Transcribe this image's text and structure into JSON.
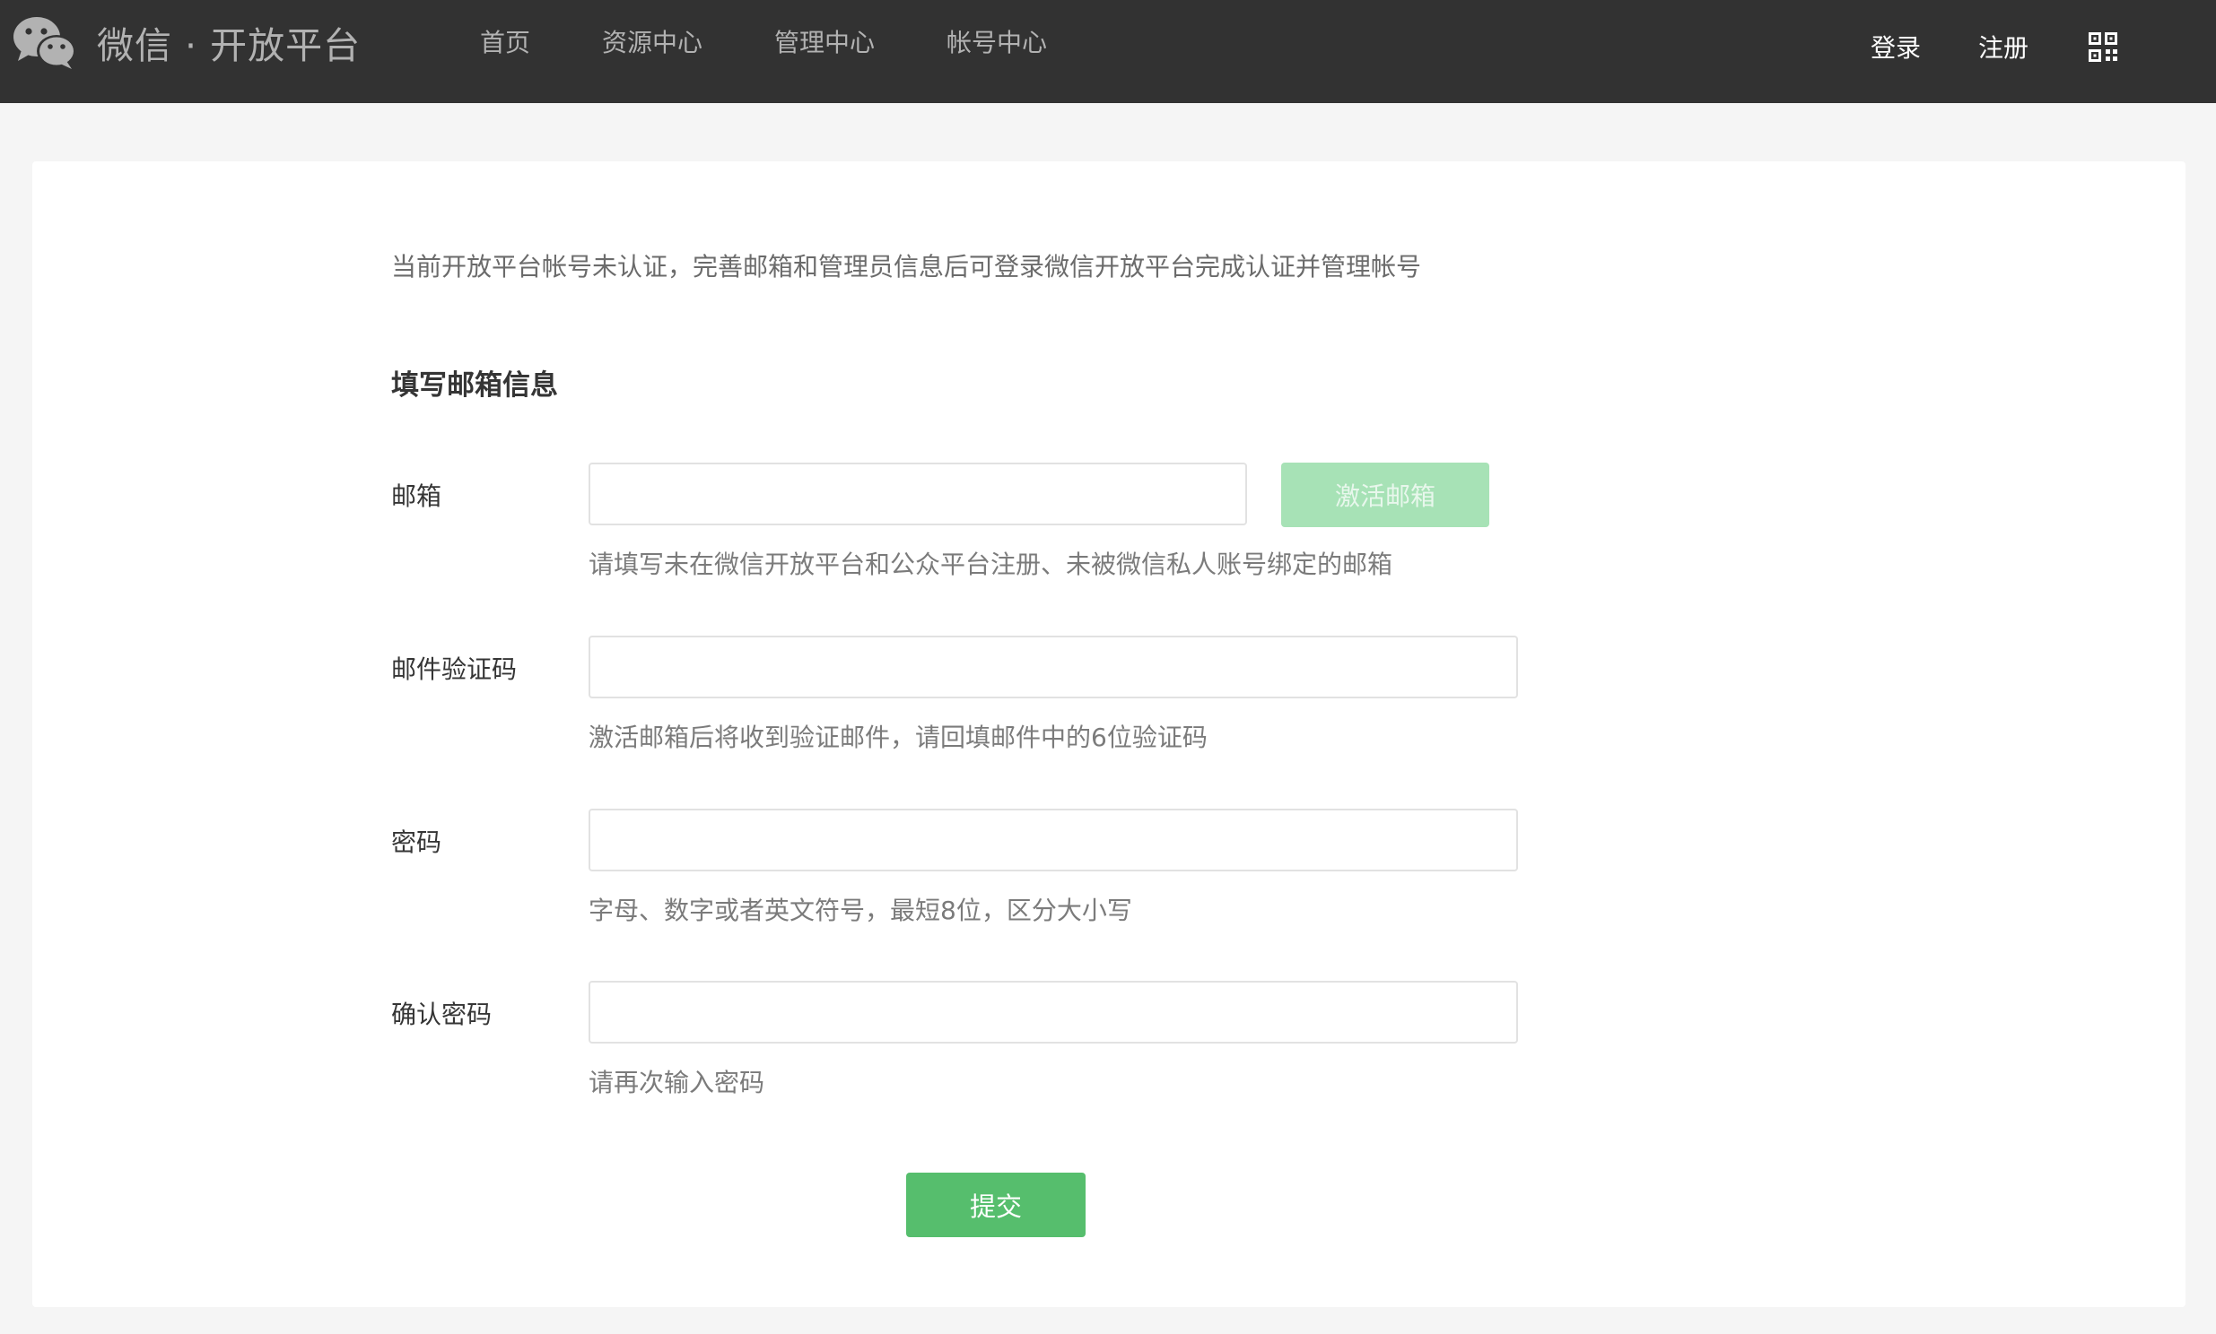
{
  "header": {
    "brand": "微信 · 开放平台",
    "nav": [
      "首页",
      "资源中心",
      "管理中心",
      "帐号中心"
    ],
    "login": "登录",
    "register": "注册"
  },
  "page": {
    "notice": "当前开放平台帐号未认证，完善邮箱和管理员信息后可登录微信开放平台完成认证并管理帐号",
    "section_title": "填写邮箱信息"
  },
  "form": {
    "email": {
      "label": "邮箱",
      "value": "",
      "hint": "请填写未在微信开放平台和公众平台注册、未被微信私人账号绑定的邮箱",
      "activate_button": "激活邮箱"
    },
    "code": {
      "label": "邮件验证码",
      "value": "",
      "hint": "激活邮箱后将收到验证邮件，请回填邮件中的6位验证码"
    },
    "password": {
      "label": "密码",
      "value": "",
      "hint": "字母、数字或者英文符号，最短8位，区分大小写"
    },
    "confirm": {
      "label": "确认密码",
      "value": "",
      "hint": "请再次输入密码"
    },
    "submit": "提交"
  },
  "colors": {
    "header_bg": "#323232",
    "primary_green": "#56be6d",
    "disabled_green": "#a7e2b6"
  },
  "icons": {
    "logo": "wechat-logo-icon",
    "qr": "qrcode-icon"
  }
}
